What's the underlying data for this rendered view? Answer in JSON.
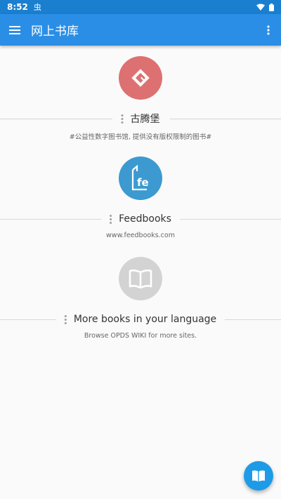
{
  "status_bar": {
    "time": "8:52",
    "notification": "虫",
    "icons": [
      "wifi-icon",
      "battery-icon"
    ]
  },
  "app_bar": {
    "title": "网上书库",
    "menu_icon": "hamburger-menu-icon",
    "more_icon": "more-vert-icon"
  },
  "libraries": [
    {
      "title": "古腾堡",
      "subtitle": "#公益性数字图书馆, 提供没有版权限制的图书#",
      "icon": "gutenberg-logo",
      "color": "#dd7171"
    },
    {
      "title": "Feedbooks",
      "subtitle": "www.feedbooks.com",
      "icon": "feedbooks-logo",
      "logo_text": "fe",
      "color": "#3c9ad1"
    },
    {
      "title": "More books in your language",
      "subtitle": "Browse OPDS WIKI for more sites.",
      "icon": "open-book-icon",
      "color": "#d3d3d3"
    }
  ],
  "fab": {
    "icon": "book-icon"
  },
  "colors": {
    "app_bar": "#2a8ee6",
    "status_bar": "#1b7fd0",
    "fab": "#1e9be6",
    "background": "#fafafa"
  }
}
